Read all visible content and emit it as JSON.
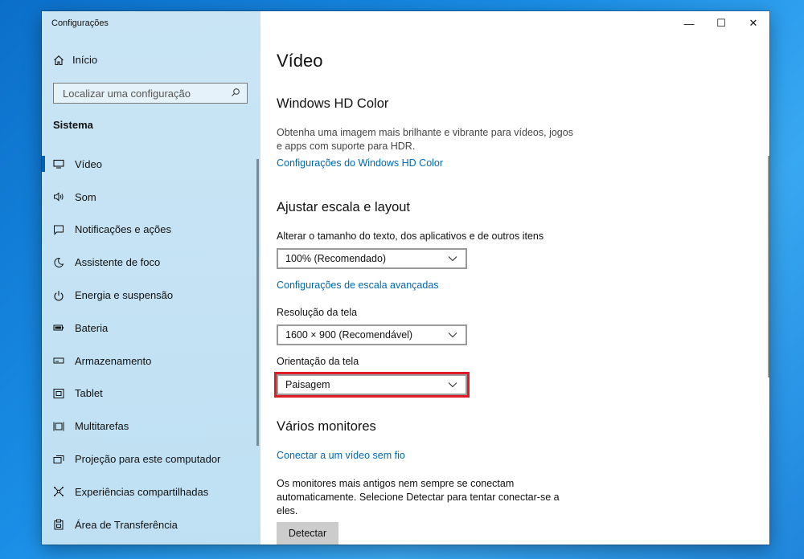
{
  "window": {
    "title": "Configurações",
    "controls": {
      "minimize": "—",
      "maximize": "☐",
      "close": "✕"
    }
  },
  "sidebar": {
    "home_label": "Início",
    "search_placeholder": "Localizar uma configuração",
    "section": "Sistema",
    "items": [
      {
        "label": "Vídeo",
        "icon": "monitor-icon",
        "active": true
      },
      {
        "label": "Som",
        "icon": "speaker-icon"
      },
      {
        "label": "Notificações e ações",
        "icon": "notification-icon"
      },
      {
        "label": "Assistente de foco",
        "icon": "moon-icon"
      },
      {
        "label": "Energia e suspensão",
        "icon": "power-icon"
      },
      {
        "label": "Bateria",
        "icon": "battery-icon"
      },
      {
        "label": "Armazenamento",
        "icon": "storage-icon"
      },
      {
        "label": "Tablet",
        "icon": "tablet-icon"
      },
      {
        "label": "Multitarefas",
        "icon": "multitask-icon"
      },
      {
        "label": "Projeção para este computador",
        "icon": "projection-icon"
      },
      {
        "label": "Experiências compartilhadas",
        "icon": "shared-icon"
      },
      {
        "label": "Área de Transferência",
        "icon": "clipboard-icon"
      }
    ]
  },
  "main": {
    "title": "Vídeo",
    "hdr": {
      "heading": "Windows HD Color",
      "description_1": "Obtenha uma imagem mais brilhante e vibrante para vídeos, jogos",
      "description_2": "e apps com suporte para HDR.",
      "link": "Configurações do Windows HD Color"
    },
    "scale": {
      "heading": "Ajustar escala e layout",
      "size_label": "Alterar o tamanho do texto, dos aplicativos e de outros itens",
      "size_value": "100% (Recomendado)",
      "advanced_link": "Configurações de escala avançadas",
      "resolution_label": "Resolução da tela",
      "resolution_value": "1600 × 900 (Recomendável)",
      "orientation_label": "Orientação da tela",
      "orientation_value": "Paisagem"
    },
    "monitors": {
      "heading": "Vários monitores",
      "wireless_link": "Conectar a um vídeo sem fio",
      "desc_1": "Os monitores mais antigos nem sempre se conectam",
      "desc_2": "automaticamente. Selecione Detectar para tentar conectar-se a",
      "desc_3": "eles.",
      "detect_button": "Detectar"
    }
  },
  "colors": {
    "sidebar_bg": "#c6e3f3",
    "accent": "#0063b1",
    "link": "#0067b8",
    "highlight": "#e01b24"
  }
}
